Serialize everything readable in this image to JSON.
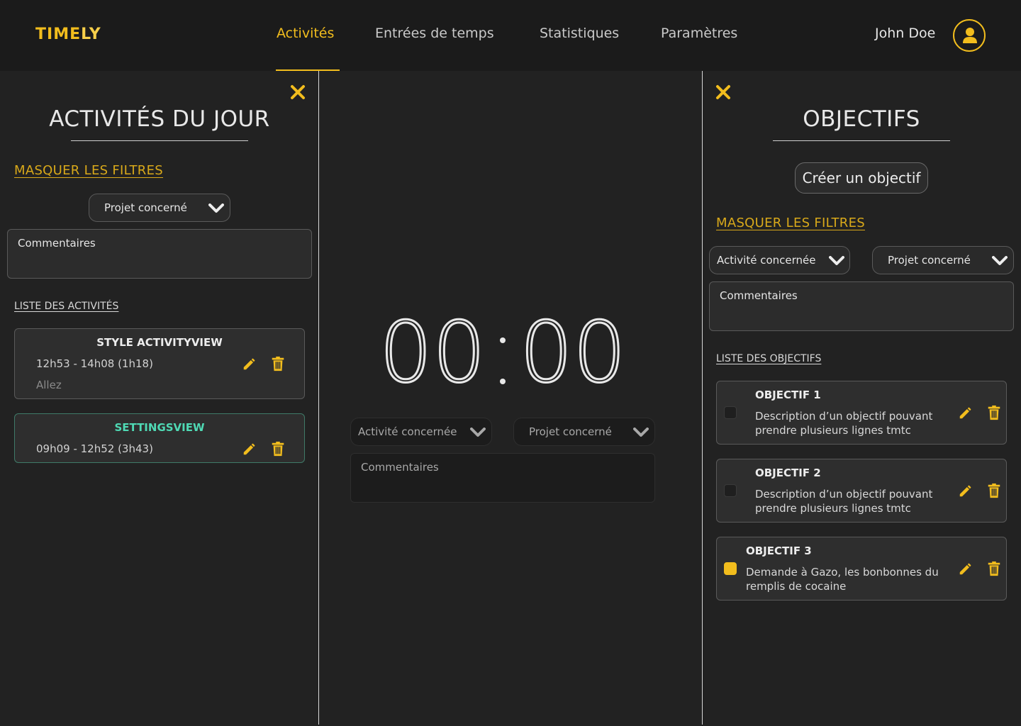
{
  "app": {
    "logo_part1": "TIME",
    "logo_part2": "LY"
  },
  "nav": {
    "items": [
      "Activités",
      "Entrées de temps",
      "Statistiques",
      "Paramètres"
    ],
    "active": "Activités"
  },
  "user": {
    "name": "John Doe",
    "avatar_icon": "user-icon"
  },
  "left_panel": {
    "title": "ACTIVITÉS DU JOUR",
    "hide_filters": "MASQUER LES FILTRES",
    "project_select": "Projet concerné",
    "comments_placeholder": "Commentaires",
    "list_title": "LISTE DES ACTIVITÉS",
    "activities": [
      {
        "title": "STYLE ACTIVITYVIEW",
        "time": "12h53 - 14h08 (1h18)",
        "comment": "Allez"
      },
      {
        "title": "SETTINGSVIEW",
        "time": "09h09 - 12h52 (3h43)"
      }
    ]
  },
  "center": {
    "timer_minutes": "00",
    "timer_seconds": "00",
    "activity_select": "Activité concernée",
    "project_select": "Projet concerné",
    "comments_placeholder": "Commentaires"
  },
  "right_panel": {
    "title": "OBJECTIFS",
    "create_button": "Créer un objectif",
    "hide_filters": "MASQUER LES FILTRES",
    "activity_select": "Activité concernée",
    "project_select": "Projet concerné",
    "comments_placeholder": "Commentaires",
    "list_title": "LISTE DES OBJECTIFS",
    "objectives": [
      {
        "title": "OBJECTIF 1",
        "desc_line1": "Description d’un objectif pouvant",
        "desc_line2": "prendre plusieurs lignes tmtc",
        "done": false
      },
      {
        "title": "OBJECTIF 2",
        "desc_line1": "Description d’un objectif pouvant",
        "desc_line2": "prendre plusieurs lignes tmtc",
        "done": false
      },
      {
        "title": "OBJECTIF 3",
        "desc_line1": "Demande à Gazo, les bonbonnes du",
        "desc_line2": "remplis de cocaine",
        "done": true
      }
    ]
  },
  "colors": {
    "accent": "#f2bd1d",
    "background": "#222222",
    "topbar": "#1b1b1b",
    "highlight": "#4fd9b4"
  }
}
